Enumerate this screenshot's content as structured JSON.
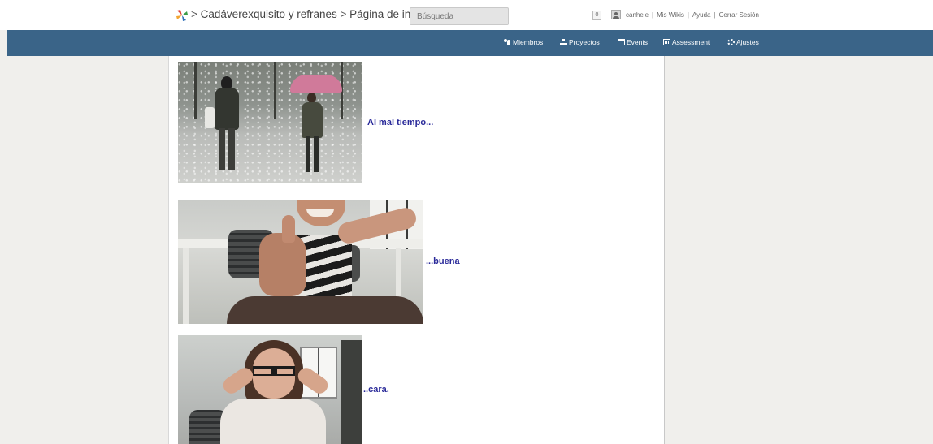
{
  "header": {
    "breadcrumb": {
      "wiki_name": "Cadáverexquisito y refranes",
      "separator": ">",
      "page_name": "Página de inicio"
    },
    "search": {
      "placeholder": "Búsqueda",
      "value": ""
    },
    "notifications": {
      "count": "0"
    },
    "user_links": {
      "username": "canhele",
      "my_wikis": "Mis Wikis",
      "help": "Ayuda",
      "logout": "Cerrar Sesión",
      "divider": "|"
    }
  },
  "nav": {
    "items": [
      {
        "label": "Miembros",
        "icon": "users-icon"
      },
      {
        "label": "Proyectos",
        "icon": "sitemap-icon"
      },
      {
        "label": "Events",
        "icon": "calendar-icon"
      },
      {
        "label": "Assessment",
        "icon": "bar-chart-icon"
      },
      {
        "label": "Ajustes",
        "icon": "gear-icon"
      }
    ]
  },
  "content": {
    "entries": [
      {
        "caption": "Al mal tiempo...",
        "image": "people-walking-in-snow-photo"
      },
      {
        "caption": "...buena",
        "image": "thumbs-up-photo"
      },
      {
        "caption": "..cara.",
        "image": "smiling-girl-glasses-photo"
      }
    ]
  },
  "colors": {
    "nav_background": "#3a6488",
    "caption_text": "#2b2b9a",
    "page_background": "#f0efec"
  }
}
